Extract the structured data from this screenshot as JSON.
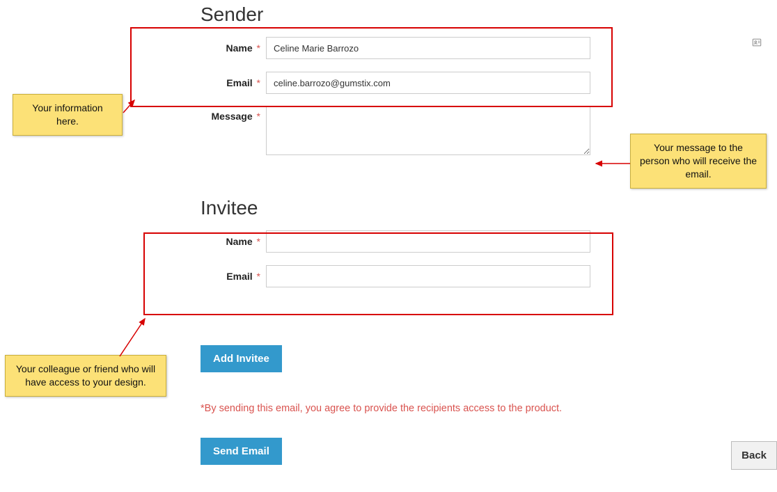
{
  "sender": {
    "heading": "Sender",
    "name_label": "Name",
    "name_value": "Celine Marie Barrozo",
    "email_label": "Email",
    "email_value": "celine.barrozo@gumstix.com",
    "message_label": "Message",
    "message_value": ""
  },
  "invitee": {
    "heading": "Invitee",
    "name_label": "Name",
    "name_value": "",
    "email_label": "Email",
    "email_value": ""
  },
  "actions": {
    "add_invitee": "Add Invitee",
    "send_email": "Send Email",
    "back": "Back"
  },
  "disclosure": "*By sending this email, you agree to provide the recipients access to the product.",
  "callouts": {
    "sender_info": "Your information here.",
    "message_info": "Your message to the person who will receive the email.",
    "invitee_info": "Your colleague or friend who will have access to your design."
  },
  "required_mark": "*"
}
